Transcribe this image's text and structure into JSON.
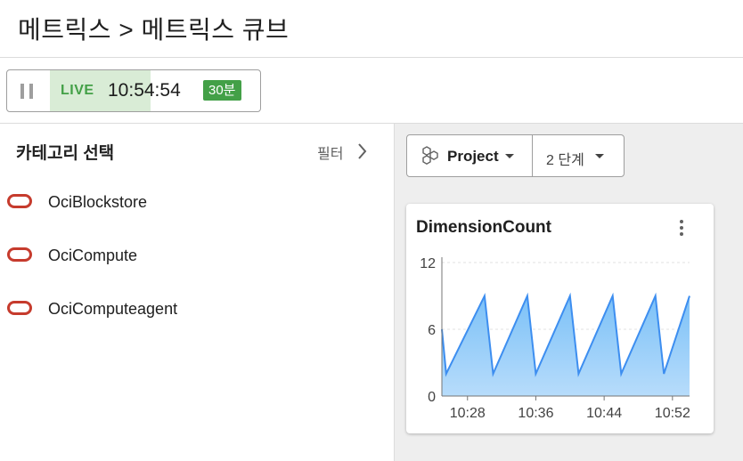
{
  "header": {
    "title": "메트릭스 > 메트릭스 큐브"
  },
  "live": {
    "label": "LIVE",
    "time": "10:54:54",
    "range": "30분"
  },
  "categories": {
    "title": "카테고리 선택",
    "filter_label": "필터",
    "items": [
      {
        "label": "OciBlockstore",
        "icon": "oci-icon"
      },
      {
        "label": "OciCompute",
        "icon": "oci-icon"
      },
      {
        "label": "OciComputeagent",
        "icon": "oci-icon"
      }
    ]
  },
  "toolbar": {
    "project_label": "Project",
    "step_label": "2 단계"
  },
  "colors": {
    "live_green": "#43a047",
    "oci_red": "#c63b2d",
    "line_blue": "#3d8ef0"
  },
  "chart": {
    "title": "DimensionCount",
    "chart_data": {
      "type": "area",
      "title": "DimensionCount",
      "xlabel": "",
      "ylabel": "",
      "ylim": [
        0,
        12
      ],
      "y_ticks": [
        "0",
        "6",
        "12"
      ],
      "x_ticks": [
        "10:28",
        "10:36",
        "10:44",
        "10:52"
      ],
      "grid": true,
      "x": [
        "10:25",
        "10:25:30",
        "10:30",
        "10:31",
        "10:35",
        "10:36",
        "10:40",
        "10:41",
        "10:45",
        "10:46",
        "10:50",
        "10:51",
        "10:54"
      ],
      "series": [
        {
          "values": [
            6.0,
            2.0,
            9.0,
            2.0,
            9.0,
            2.0,
            9.0,
            2.0,
            9.0,
            2.0,
            9.0,
            2.0,
            9.0
          ]
        }
      ]
    }
  }
}
